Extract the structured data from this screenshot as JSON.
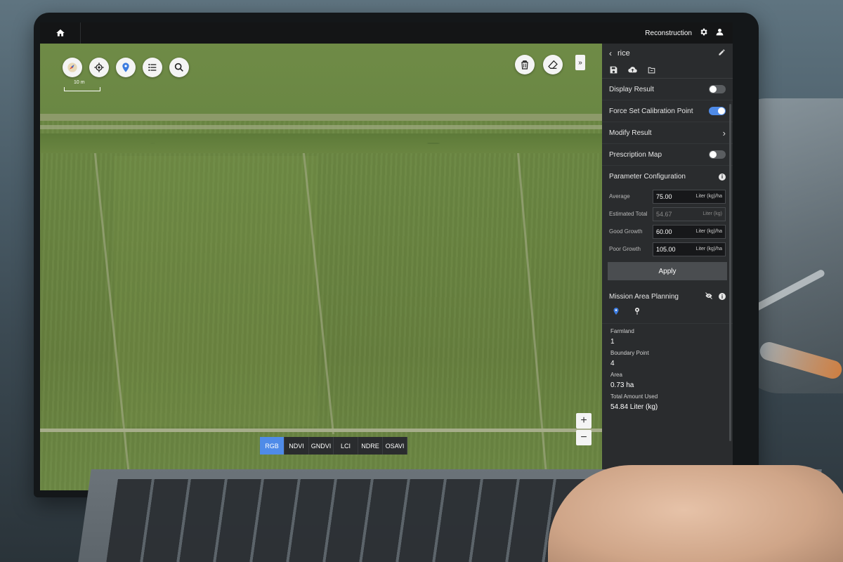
{
  "topbar": {
    "title": "Reconstruction"
  },
  "map": {
    "scale_label": "10 m",
    "index_buttons": [
      "RGB",
      "NDVI",
      "GNDVI",
      "LCI",
      "NDRE",
      "OSAVI"
    ],
    "active_index": "RGB",
    "zoom_in": "+",
    "zoom_out": "−",
    "collapse_label": "»"
  },
  "panel": {
    "title": "rice",
    "display_result": {
      "label": "Display Result",
      "on": false
    },
    "force_calibration": {
      "label": "Force Set Calibration Point",
      "on": true
    },
    "modify_result": {
      "label": "Modify Result"
    },
    "prescription_map": {
      "label": "Prescription Map",
      "on": false
    },
    "parameter_configuration": {
      "label": "Parameter Configuration",
      "average": {
        "label": "Average",
        "value": "75.00",
        "unit": "Liter (kg)/ha"
      },
      "estimated_total": {
        "label": "Estimated Total",
        "value": "54.67",
        "unit": "Liter (kg)"
      },
      "good_growth": {
        "label": "Good Growth",
        "value": "60.00",
        "unit": "Liter (kg)/ha"
      },
      "poor_growth": {
        "label": "Poor Growth",
        "value": "105.00",
        "unit": "Liter (kg)/ha"
      },
      "apply_label": "Apply"
    },
    "mission_area_planning": {
      "label": "Mission Area Planning",
      "farmland": {
        "label": "Farmland",
        "value": "1"
      },
      "boundary_point": {
        "label": "Boundary Point",
        "value": "4"
      },
      "area": {
        "label": "Area",
        "value": "0.73 ha"
      },
      "total_amount_used": {
        "label": "Total Amount Used",
        "value": "54.84 Liter (kg)"
      }
    }
  },
  "colors": {
    "accent": "#4f8be8",
    "panel_bg": "#2a2c2e",
    "topbar_bg": "#141516"
  },
  "icons": [
    "home-icon",
    "gear-icon",
    "user-icon",
    "compass-icon",
    "locate-icon",
    "map-pin-icon",
    "list-icon",
    "search-icon",
    "trash-icon",
    "eraser-icon",
    "save-icon",
    "cloud-upload-icon",
    "export-icon",
    "edit-icon",
    "eye-off-icon",
    "info-icon"
  ]
}
